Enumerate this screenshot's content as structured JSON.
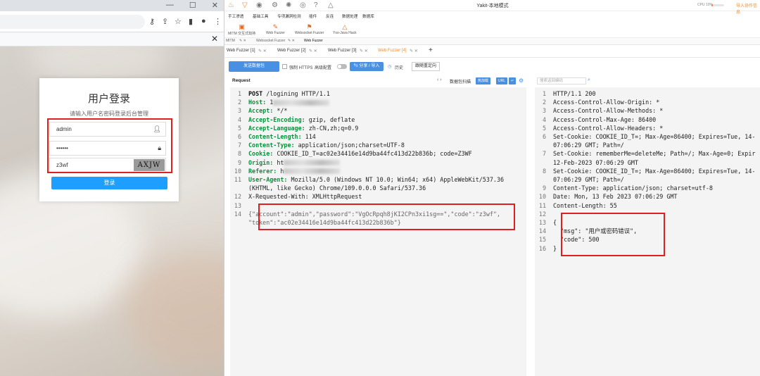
{
  "browser": {
    "window_controls": [
      "—",
      "☐",
      "✕"
    ],
    "login": {
      "title": "用户登录",
      "subtitle": "请输入用户名密码登录后台管理",
      "username": "admin",
      "password": "••••••",
      "code": "z3wf",
      "captcha": "AXJW",
      "submit_label": "登录"
    }
  },
  "app": {
    "title": "Yakit-本地模式",
    "cpu_label": "CPU 10%",
    "cpu_level": 0.1,
    "help_text": "导入协作信息",
    "menu": [
      "手工渗透",
      "基础工具",
      "专项漏洞检测",
      "插件",
      "反连",
      "数据处理",
      "数据库"
    ],
    "tools": [
      "MITM 交互式劫持",
      "Web Fuzzer",
      "Websocket Fuzzer",
      "Yso-Java Hack"
    ],
    "top_tabs": [
      "MITM",
      "Websocket Fuzzer",
      "Web Fuzzer"
    ],
    "fuzzer_tabs": [
      "Web Fuzzer [1]",
      "Web Fuzzer [2]",
      "Web Fuzzer [3]",
      "Web Fuzzer [4]"
    ],
    "active_tab_index": 3,
    "toolbar": {
      "send": "发送数据包",
      "https": "强制 HTTPS",
      "advanced": "高级配置",
      "share": "分享 / 导入",
      "history": "历史",
      "redirect": "跟随重定向"
    },
    "request": {
      "label": "Request",
      "scan": "数据包扫描",
      "badges": [
        "热加载",
        "URL"
      ],
      "lines": [
        {
          "n": "1",
          "k": "",
          "v": "POST /logining HTTP/1.1",
          "method": true
        },
        {
          "n": "2",
          "k": "Host:",
          "v": " 1",
          "blur": true
        },
        {
          "n": "3",
          "k": "Accept:",
          "v": " */*"
        },
        {
          "n": "4",
          "k": "Accept-Encoding:",
          "v": " gzip, deflate"
        },
        {
          "n": "5",
          "k": "Accept-Language:",
          "v": " zh-CN,zh;q=0.9"
        },
        {
          "n": "6",
          "k": "Content-Length:",
          "v": " 114"
        },
        {
          "n": "7",
          "k": "Content-Type:",
          "v": " application/json;charset=UTF-8"
        },
        {
          "n": "8",
          "k": "Cookie:",
          "v": " COOKIE_ID_T=ac02e34416e14d9ba44fc413d22b836b; code=Z3WF"
        },
        {
          "n": "9",
          "k": "Origin:",
          "v": " ht",
          "blur": true
        },
        {
          "n": "10",
          "k": "Referer:",
          "v": " h",
          "blur": true
        },
        {
          "n": "11",
          "k": "User-Agent:",
          "v": " Mozilla/5.0 (Windows NT 10.0; Win64; x64) AppleWebKit/537.36"
        },
        {
          "n": "",
          "k": "",
          "v": "(KHTML, like Gecko) Chrome/109.0.0.0 Safari/537.36"
        },
        {
          "n": "12",
          "k": "",
          "v": "X-Requested-With: XMLHttpRequest"
        },
        {
          "n": "13",
          "k": "",
          "v": ""
        },
        {
          "n": "14",
          "k": "",
          "v": "{\"account\":\"admin\",\"password\":\"VgOcRpqh8jKI2CPn3xi1sg==\",\"code\":\"z3wf\",",
          "str": true
        },
        {
          "n": "",
          "k": "",
          "v": "\"token\":\"ac02e34416e14d9ba44fc413d22b836b\"}",
          "str": true
        }
      ]
    },
    "response": {
      "search_placeholder": "搜索返回编码",
      "lines": [
        {
          "n": "1",
          "v": "HTTP/1.1 200"
        },
        {
          "n": "2",
          "v": "Access-Control-Allow-Origin: *"
        },
        {
          "n": "3",
          "v": "Access-Control-Allow-Methods: *"
        },
        {
          "n": "4",
          "v": "Access-Control-Max-Age: 86400"
        },
        {
          "n": "5",
          "v": "Access-Control-Allow-Headers: *"
        },
        {
          "n": "6",
          "v": "Set-Cookie: COOKIE_ID_T=; Max-Age=86400; Expires=Tue, 14-"
        },
        {
          "n": "",
          "v": "07:06:29 GMT; Path=/"
        },
        {
          "n": "7",
          "v": "Set-Cookie: rememberMe=deleteMe; Path=/; Max-Age=0; Expir"
        },
        {
          "n": "",
          "v": "12-Feb-2023 07:06:29 GMT"
        },
        {
          "n": "8",
          "v": "Set-Cookie: COOKIE_ID_T=; Max-Age=86400; Expires=Tue, 14-"
        },
        {
          "n": "",
          "v": "07:06:29 GMT; Path=/"
        },
        {
          "n": "9",
          "v": "Content-Type: application/json; charset=utf-8"
        },
        {
          "n": "10",
          "v": "Date: Mon, 13 Feb 2023 07:06:29 GMT"
        },
        {
          "n": "11",
          "v": "Content-Length: 55"
        },
        {
          "n": "12",
          "v": ""
        },
        {
          "n": "13",
          "v": "{"
        },
        {
          "n": "14",
          "v": "  \"msg\": \"用户或密码错误\","
        },
        {
          "n": "15",
          "v": "  \"code\": 500"
        },
        {
          "n": "16",
          "v": "}"
        }
      ]
    }
  }
}
